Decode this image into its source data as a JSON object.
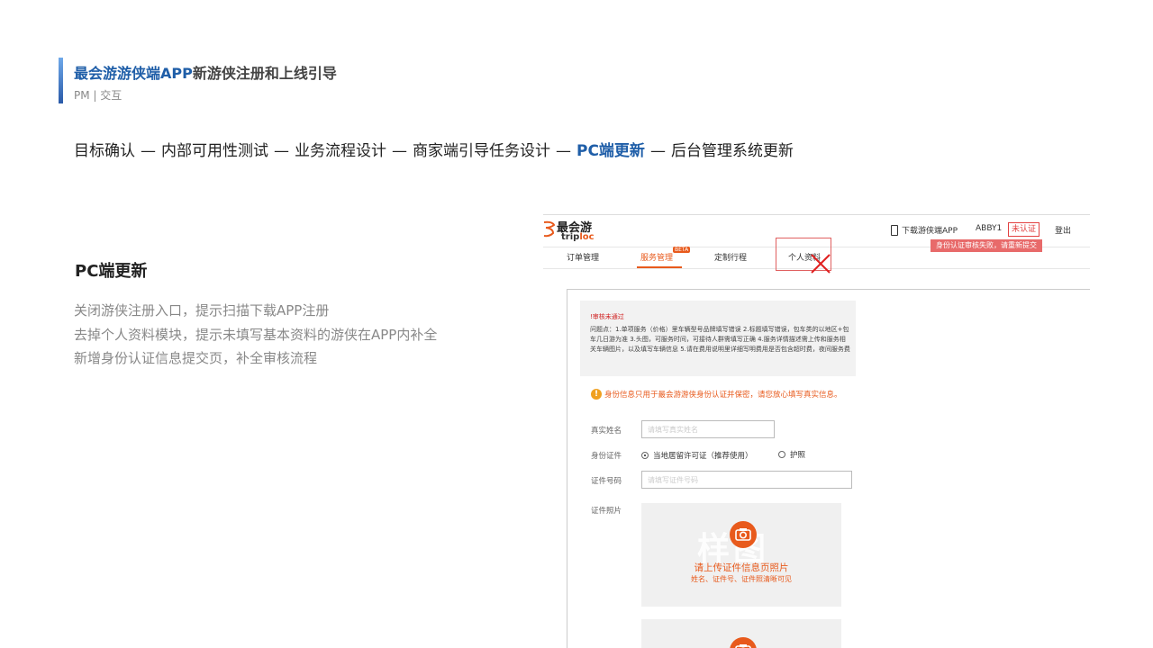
{
  "header": {
    "title_highlight": "最会游游侠端APP",
    "title_rest": "新游侠注册和上线引导",
    "subtitle": "PM | 交互"
  },
  "flow": {
    "steps": [
      "目标确认",
      "内部可用性测试",
      "业务流程设计",
      "商家端引导任务设计",
      "PC端更新",
      "后台管理系统更新"
    ],
    "separator": "—",
    "active_step": "PC端更新"
  },
  "section": {
    "title": "PC端更新",
    "lines": [
      "关闭游侠注册入口，提示扫描下载APP注册",
      "去掉个人资料模块，提示未填写基本资料的游侠在APP内补全",
      "新增身份认证信息提交页，补全审核流程"
    ]
  },
  "mock": {
    "logo_cn": "最会游",
    "logo_en_a": "trip",
    "logo_en_b": "loc",
    "download": "下载游侠端APP",
    "user": "ABBY1",
    "unverified": "未认证",
    "logout": "登出",
    "red_tip": "身份认证审核失败，请重新提交",
    "nav": [
      "订单管理",
      "服务管理",
      "定制行程",
      "个人资料"
    ],
    "active_nav": "服务管理",
    "beta": "BETA",
    "notice_title": "!审核未通过",
    "notice_body": "问题点：1.单项服务（价格）里车辆型号品牌填写错误 2.标题填写错误，包车类的以地区+包车几日游为准 3.头图，可服务时间，可接待人群需填写正确 4.服务详情描述需上传和服务相关车辆图片，以及填写车辆信息 5.请在费用说明里详细写明费用是否包含超时费，夜间服务费",
    "warn_icon": "!",
    "warn_text": "身份信息只用于最会游游侠身份认证并保密，请您放心填写真实信息。",
    "label_name": "真实姓名",
    "placeholder_name": "请填写真实姓名",
    "label_idtype": "身份证件",
    "option1": "当地居留许可证（推荐使用）",
    "option2": "护照",
    "label_idnum": "证件号码",
    "placeholder_idnum": "请填写证件号码",
    "label_photo": "证件照片",
    "watermark": "样图",
    "upload_title": "请上传证件信息页照片",
    "upload_sub": "姓名、证件号、证件照清晰可见"
  },
  "colors": {
    "accent_blue": "#1f5ea8",
    "brand_orange": "#e85a1c",
    "error_red": "#e24040"
  }
}
